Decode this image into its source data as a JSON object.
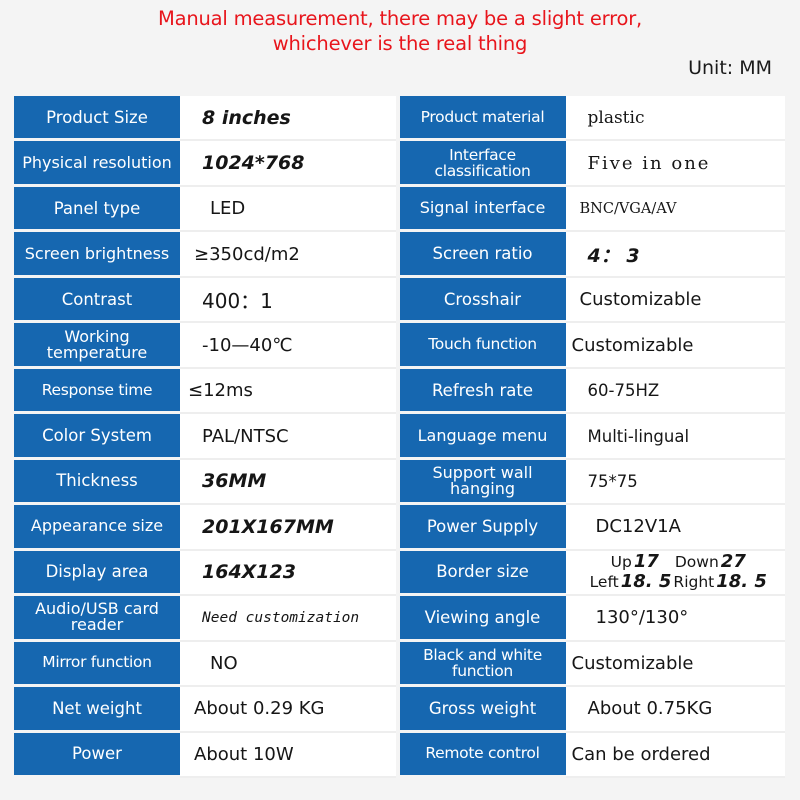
{
  "notice": {
    "line1": "Manual measurement, there may be a slight error,",
    "line2": "whichever is the real thing",
    "color": "#e8151c"
  },
  "unit_label": "Unit: MM",
  "theme": {
    "label_bg": "#1667b0",
    "label_text": "#ffffff",
    "value_bg": "#ffffff",
    "page_bg": "#f4f4f4"
  },
  "rows": [
    {
      "left": {
        "label": "Product Size",
        "value": "8 inches"
      },
      "right": {
        "label": "Product material",
        "value": "plastic"
      }
    },
    {
      "left": {
        "label": "Physical resolution",
        "value": "1024*768"
      },
      "right": {
        "label": "Interface classification",
        "value": "Five in one"
      }
    },
    {
      "left": {
        "label": "Panel type",
        "value": "LED"
      },
      "right": {
        "label": "Signal interface",
        "value": "BNC/VGA/AV"
      }
    },
    {
      "left": {
        "label": "Screen brightness",
        "value": "≥350cd/m2"
      },
      "right": {
        "label": "Screen ratio",
        "value": "4： 3"
      }
    },
    {
      "left": {
        "label": "Contrast",
        "value": "400：1"
      },
      "right": {
        "label": "Crosshair",
        "value": "Customizable"
      }
    },
    {
      "left": {
        "label": "Working temperature",
        "value": "-10—40℃"
      },
      "right": {
        "label": "Touch function",
        "value": "Customizable"
      }
    },
    {
      "left": {
        "label": "Response time",
        "value": "≤12ms"
      },
      "right": {
        "label": "Refresh rate",
        "value": "60-75HZ"
      }
    },
    {
      "left": {
        "label": "Color System",
        "value": "PAL/NTSC"
      },
      "right": {
        "label": "Language menu",
        "value": "Multi-lingual"
      }
    },
    {
      "left": {
        "label": "Thickness",
        "value": "36MM"
      },
      "right": {
        "label": "Support wall hanging",
        "value": "75*75"
      }
    },
    {
      "left": {
        "label": "Appearance size",
        "value": "201X167MM"
      },
      "right": {
        "label": "Power Supply",
        "value": "DC12V1A"
      }
    },
    {
      "left": {
        "label": "Display area",
        "value": "164X123"
      },
      "right": {
        "label": "Border size",
        "value": {
          "up_label": "Up",
          "up_value": "17",
          "down_label": "Down",
          "down_value": "27",
          "left_label": "Left",
          "left_value": "18. 5",
          "right_label": "Right",
          "right_value": "18. 5"
        }
      }
    },
    {
      "left": {
        "label": "Audio/USB card reader",
        "value": "Need customization"
      },
      "right": {
        "label": "Viewing angle",
        "value": "130°/130°"
      }
    },
    {
      "left": {
        "label": "Mirror function",
        "value": "NO"
      },
      "right": {
        "label": "Black and white function",
        "value": "Customizable"
      }
    },
    {
      "left": {
        "label": "Net weight",
        "value": "About 0.29 KG"
      },
      "right": {
        "label": "Gross weight",
        "value": "About 0.75KG"
      }
    },
    {
      "left": {
        "label": "Power",
        "value": "About 10W"
      },
      "right": {
        "label": "Remote control",
        "value": "Can be ordered"
      }
    }
  ]
}
